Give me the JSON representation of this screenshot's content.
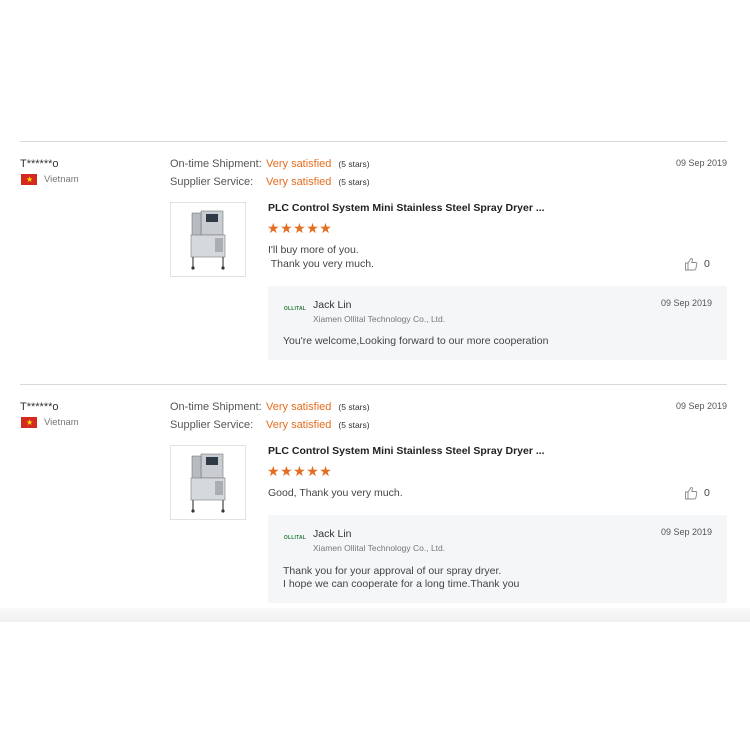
{
  "reviews": [
    {
      "user": "T******o",
      "country": "Vietnam",
      "shipment_label": "On-time Shipment:",
      "shipment_value": "Very satisfied",
      "shipment_stars": "(5 stars)",
      "service_label": "Supplier Service:",
      "service_value": "Very satisfied",
      "service_stars": "(5 stars)",
      "date": "09 Sep 2019",
      "product": "PLC Control System Mini Stainless Steel Spray Dryer ...",
      "rating": 5,
      "comment": "I'll buy more of you.\n Thank you very much.",
      "likes": "0",
      "reply": {
        "logo": "OLLITAL",
        "name": "Jack Lin",
        "company": "Xiamen Ollital Technology Co., Ltd.",
        "date": "09 Sep 2019",
        "text": "You're welcome,Looking forward to our more cooperation"
      }
    },
    {
      "user": "T******o",
      "country": "Vietnam",
      "shipment_label": "On-time Shipment:",
      "shipment_value": "Very satisfied",
      "shipment_stars": "(5 stars)",
      "service_label": "Supplier Service:",
      "service_value": "Very satisfied",
      "service_stars": "(5 stars)",
      "date": "09 Sep 2019",
      "product": "PLC Control System Mini Stainless Steel Spray Dryer ...",
      "rating": 5,
      "comment": "Good, Thank you very much.",
      "likes": "0",
      "reply": {
        "logo": "OLLITAL",
        "name": "Jack Lin",
        "company": "Xiamen Ollital Technology Co., Ltd.",
        "date": "09 Sep 2019",
        "text": "Thank you for your approval of our spray dryer.\nI hope we can cooperate for a long time.Thank you"
      }
    }
  ],
  "colors": {
    "accent": "#e46d1f",
    "reply_bg": "#f5f6f8",
    "flag_red": "#d3291f",
    "flag_star": "#ffde00"
  },
  "icons": {
    "flag": "vietnam-flag-icon",
    "like": "thumbs-up-icon",
    "star": "star-icon"
  }
}
